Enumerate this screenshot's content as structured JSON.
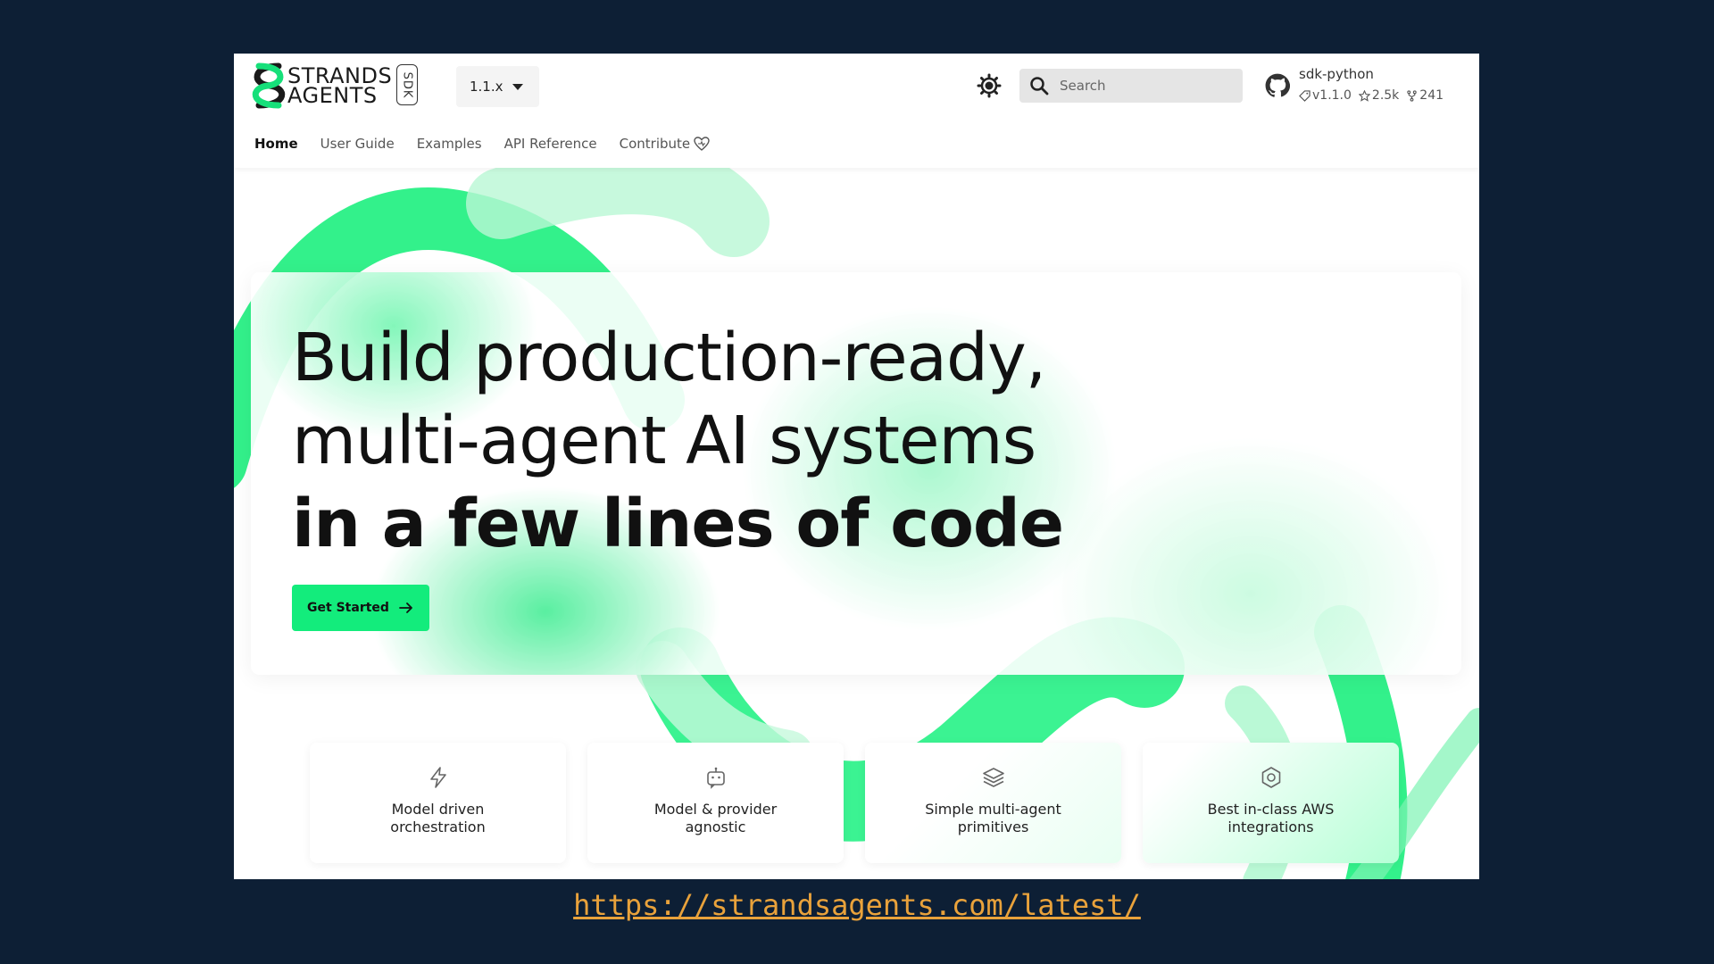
{
  "header": {
    "brand_line1": "STRANDS",
    "brand_line2": "AGENTS",
    "sdk_badge": "SDK",
    "version": "1.1.x",
    "search_placeholder": "Search",
    "repo": {
      "name": "sdk-python",
      "version": "v1.1.0",
      "stars": "2.5k",
      "forks": "241"
    }
  },
  "nav": {
    "tabs": [
      {
        "label": "Home",
        "active": true
      },
      {
        "label": "User Guide"
      },
      {
        "label": "Examples"
      },
      {
        "label": "API Reference"
      },
      {
        "label": "Contribute"
      }
    ]
  },
  "hero": {
    "line1": "Build production-ready,",
    "line2": "multi-agent AI systems",
    "line3": "in a few lines of code",
    "cta_label": "Get Started"
  },
  "features": [
    {
      "icon": "lightning-icon",
      "line1": "Model driven",
      "line2": "orchestration"
    },
    {
      "icon": "bot-icon",
      "line1": "Model & provider",
      "line2": "agnostic"
    },
    {
      "icon": "layers-icon",
      "line1": "Simple multi-agent",
      "line2": "primitives"
    },
    {
      "icon": "hexagon-icon",
      "line1": "Best in-class AWS",
      "line2": "integrations"
    }
  ],
  "footer_url": "https://strandsagents.com/latest/",
  "colors": {
    "background": "#0d1f35",
    "accent_green": "#13ec7c",
    "url": "#e9a23b"
  }
}
